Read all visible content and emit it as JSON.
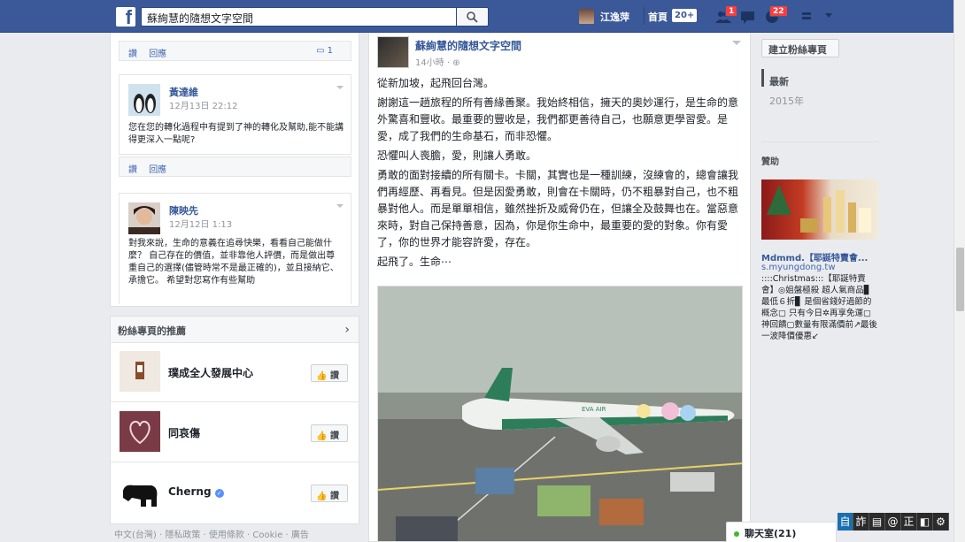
{
  "topbar": {
    "search_value": "蘇絢慧的隨想文字空間",
    "user_name": "江逸萍",
    "home_label": "首頁",
    "home_count": "20+",
    "friend_badge": "1",
    "notif_badge": "22"
  },
  "left": {
    "top_actions": {
      "like": "讚",
      "reply": "回應",
      "count": "1"
    },
    "comments": [
      {
        "name": "黃達維",
        "time": "12月13日 22:12",
        "text": "您在您的轉化過程中有提到了神的轉化及幫助,能不能講得更深入一點呢?"
      },
      {
        "name": "陳映先",
        "time": "12月12日 1:13",
        "text": "對我來說，生命的意義在追尋快樂，看看自己能做什麼？ 自己存在的價值，並非靠他人評價，而是做出尊重自己的選擇(儘管時常不是最正確的)，並且接納它、承擔它。 希望對您寫作有些幫助"
      }
    ],
    "second_actions": {
      "like": "讚",
      "reply": "回應"
    },
    "recommend": {
      "title": "粉絲專頁的推薦",
      "items": [
        {
          "name": "璞成全人發展中心",
          "like": "讚"
        },
        {
          "name": "同哀傷",
          "like": "讚"
        },
        {
          "name": "Cherng",
          "like": "讚"
        }
      ]
    },
    "footer": "中文(台灣) · 隱私政策 · 使用條款 · Cookie · 廣告"
  },
  "post": {
    "page_name": "蘇絢慧的隨想文字空間",
    "time": "14小時",
    "paragraphs": [
      "從新加坡，起飛回台灣。",
      "謝謝這一趟旅程的所有善緣善聚。我始終相信，擁天的奧妙運行，是生命的意外驚喜和豐收。最重要的豐收是，我們都更善待自己，也願意更學習愛。是愛，成了我們的生命基石，而非恐懼。",
      "恐懼叫人喪膽，愛，則讓人勇敢。",
      "勇敢的面對接續的所有關卡。卡關，其實也是一種訓練，沒練會的，總會讓我們再經歷、再看見。但是因愛勇敢，則會在卡關時，仍不粗暴對自己，也不粗暴對他人。而是單單相信，雖然挫折及威脅仍在，但讓全及鼓舞也在。當惡意來時，對自己保持善意，因為，你是你生命中，最重要的愛的對象。你有愛了，你的世界才能容許愛，存在。",
      "起飛了。生命⋯"
    ],
    "plane_livery": "EVA AIR"
  },
  "right": {
    "create_page": "建立粉絲專頁",
    "timeline_latest": "最新",
    "timeline_year": "2015年",
    "sponsored": "贊助",
    "ad_title": "Mdmmd.【耶誕特賣會...",
    "ad_url": "s.myungdong.tw",
    "ad_text": "::::Christmas:::【耶誕特賣會】◎姐盤極殺 超人氣商品▊ 最低６折▊ 是個省錢好過節的概念▢ 只有今日✲再享免運▢神回饋▢數量有限滿價前↗最後一波降價優惠↙"
  },
  "chat": {
    "label": "聊天室(21)"
  },
  "ime": [
    "自",
    "詐",
    "▤",
    "@",
    "正",
    "◧",
    "⚙"
  ]
}
